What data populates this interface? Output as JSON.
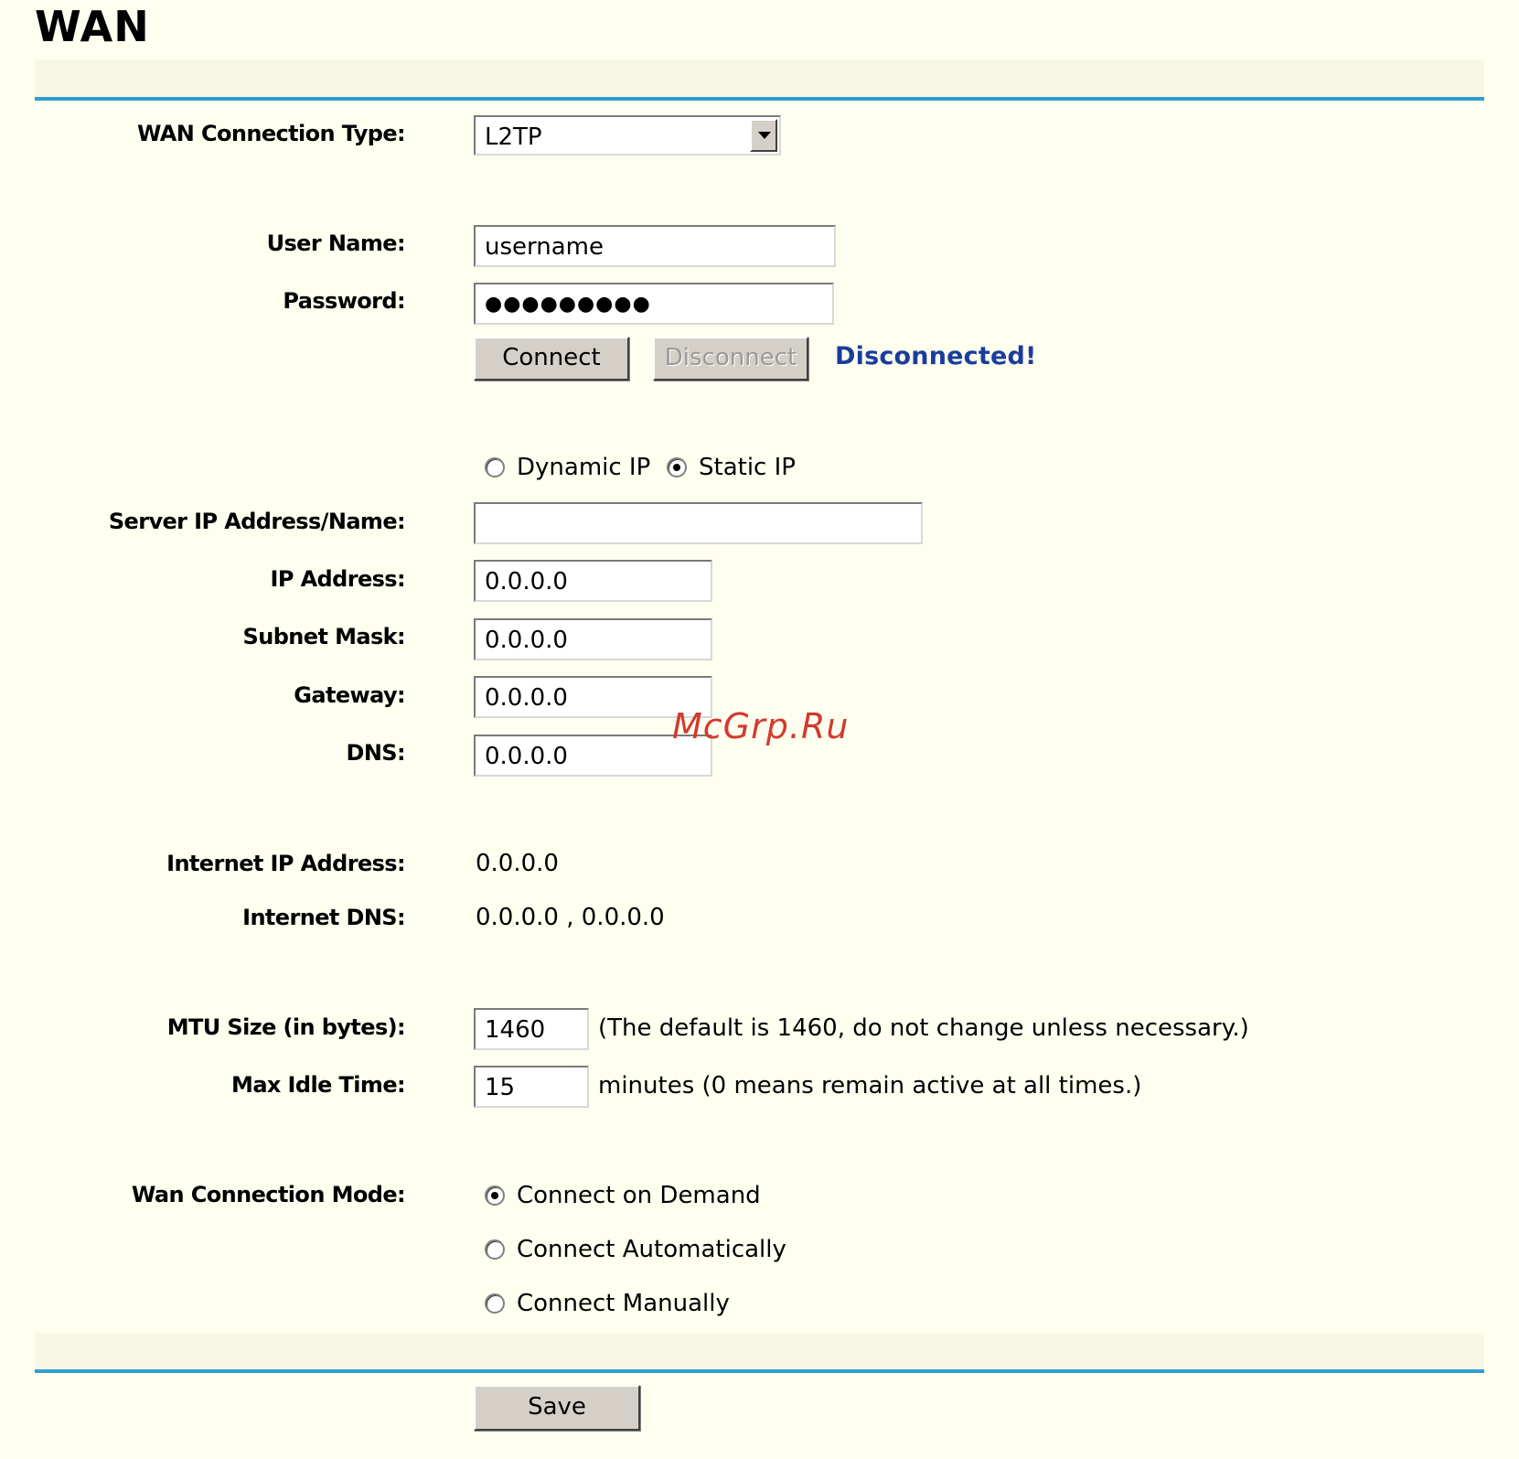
{
  "page": {
    "title": "WAN"
  },
  "form": {
    "wan_connection_type": {
      "label": "WAN Connection Type:",
      "selected": "L2TP"
    },
    "user_name": {
      "label": "User Name:",
      "value": "username"
    },
    "password": {
      "label": "Password:",
      "masked_value": "●●●●●●●●●"
    },
    "connect_label": "Connect",
    "disconnect_label": "Disconnect",
    "connection_status": "Disconnected!",
    "ip_mode": {
      "dynamic_label": "Dynamic IP",
      "static_label": "Static IP",
      "selected": "static"
    },
    "server_ip": {
      "label": "Server IP Address/Name:",
      "value": ""
    },
    "ip_address": {
      "label": "IP Address:",
      "value": "0.0.0.0"
    },
    "subnet_mask": {
      "label": "Subnet Mask:",
      "value": "0.0.0.0"
    },
    "gateway": {
      "label": "Gateway:",
      "value": "0.0.0.0"
    },
    "dns": {
      "label": "DNS:",
      "value": "0.0.0.0"
    },
    "internet_ip": {
      "label": "Internet IP Address:",
      "value": "0.0.0.0"
    },
    "internet_dns": {
      "label": "Internet DNS:",
      "value": "0.0.0.0 , 0.0.0.0"
    },
    "mtu": {
      "label": "MTU Size (in bytes):",
      "value": "1460",
      "hint": "(The default is 1460, do not change unless necessary.)"
    },
    "max_idle": {
      "label": "Max Idle Time:",
      "value": "15",
      "hint": "minutes (0 means remain active at all times.)"
    },
    "connection_mode": {
      "label": "Wan Connection Mode:",
      "options": [
        "Connect on Demand",
        "Connect Automatically",
        "Connect Manually"
      ],
      "selected": "Connect on Demand"
    },
    "save_label": "Save"
  },
  "watermark": "McGrp.Ru",
  "colors": {
    "background": "#fffff0",
    "divider": "#2e9fd0",
    "status": "#1a3d9c",
    "watermark": "#d23a2e"
  }
}
